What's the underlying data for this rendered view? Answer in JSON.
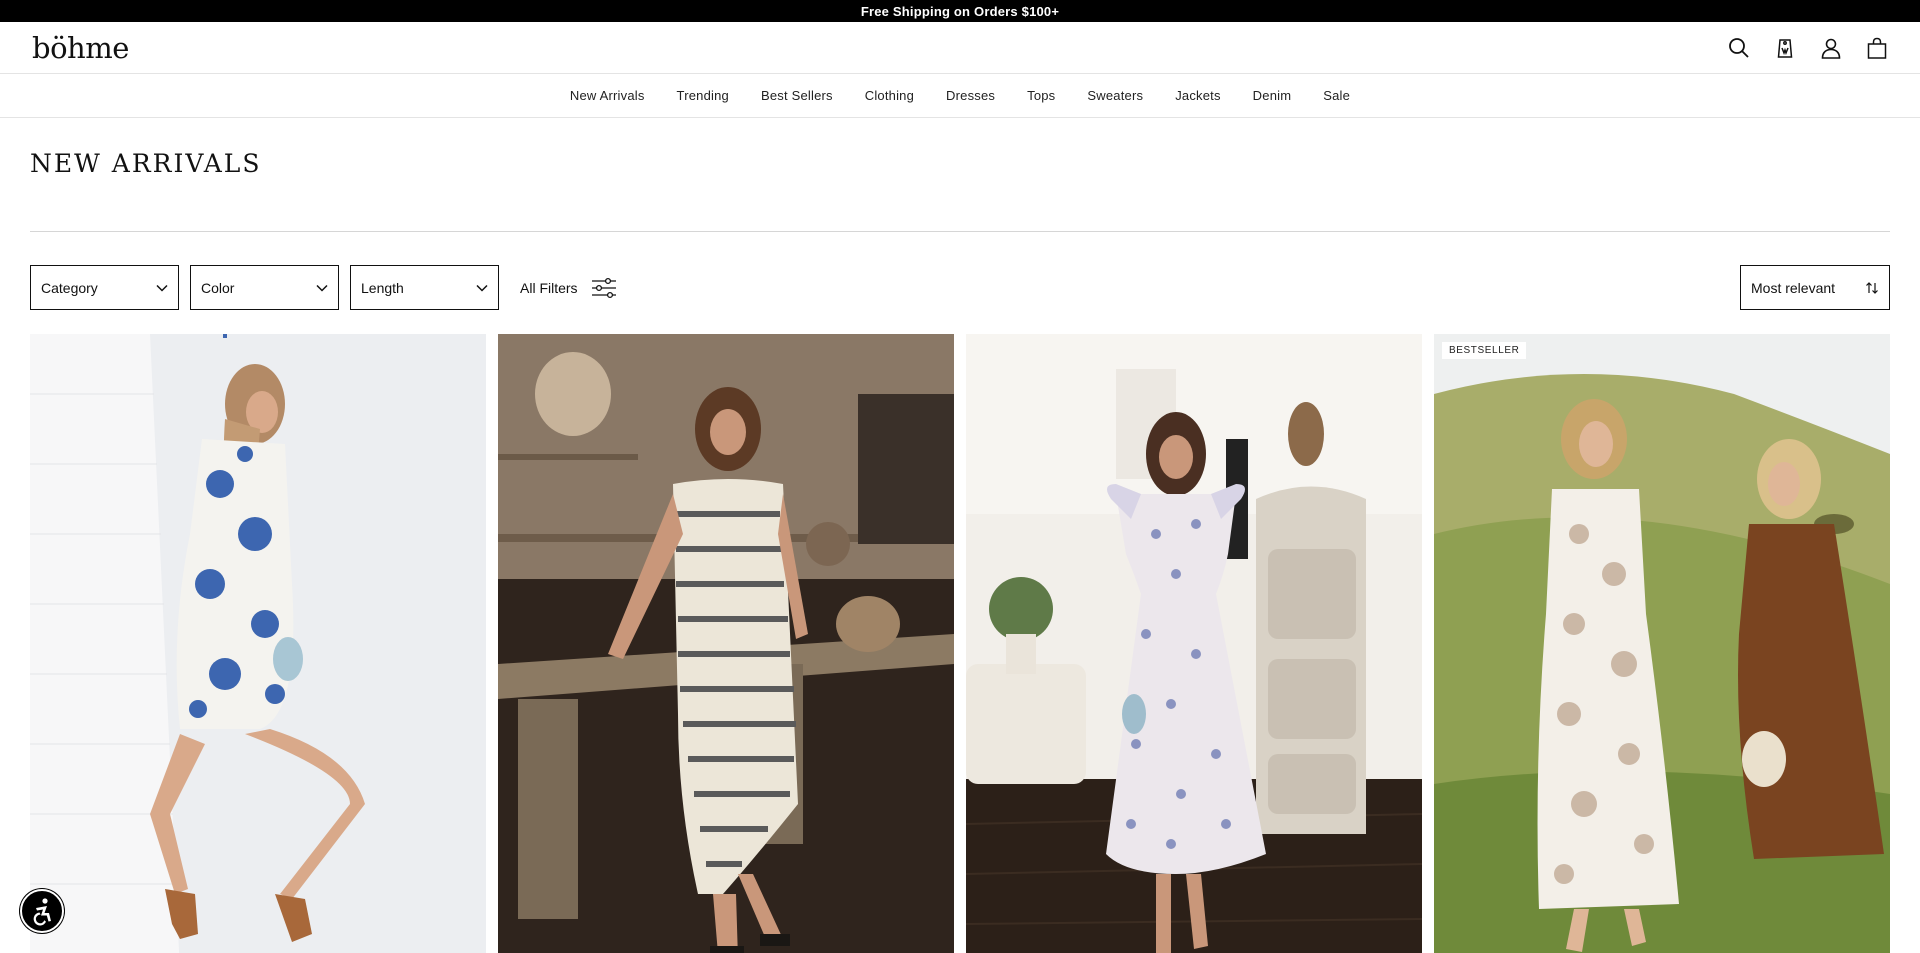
{
  "promo": {
    "text": "Free Shipping on Orders $100+"
  },
  "header": {
    "logo": "böhme",
    "icons": [
      "search-icon",
      "wishlist-tag-icon",
      "account-icon",
      "cart-icon"
    ]
  },
  "nav": {
    "items": [
      "New Arrivals",
      "Trending",
      "Best Sellers",
      "Clothing",
      "Dresses",
      "Tops",
      "Sweaters",
      "Jackets",
      "Denim",
      "Sale"
    ]
  },
  "page": {
    "title": "NEW ARRIVALS"
  },
  "filters": {
    "category": "Category",
    "color": "Color",
    "length": "Length",
    "all_filters": "All Filters",
    "sort": "Most relevant"
  },
  "products": [
    {
      "badge": "",
      "image": "model in blue floral mini dress leaning against white brick wall"
    },
    {
      "badge": "",
      "image": "model in cream striped sleeveless midi dress sitting on wooden table"
    },
    {
      "badge": "",
      "image": "model in lavender floral ruffle sleeve midi dress in living room"
    },
    {
      "badge": "BESTSELLER",
      "image": "two models in floral maxi and brown dresses on grassy hillside"
    }
  ],
  "colors": {
    "promo_bg": "#000000",
    "border": "#111111",
    "text": "#111111"
  }
}
